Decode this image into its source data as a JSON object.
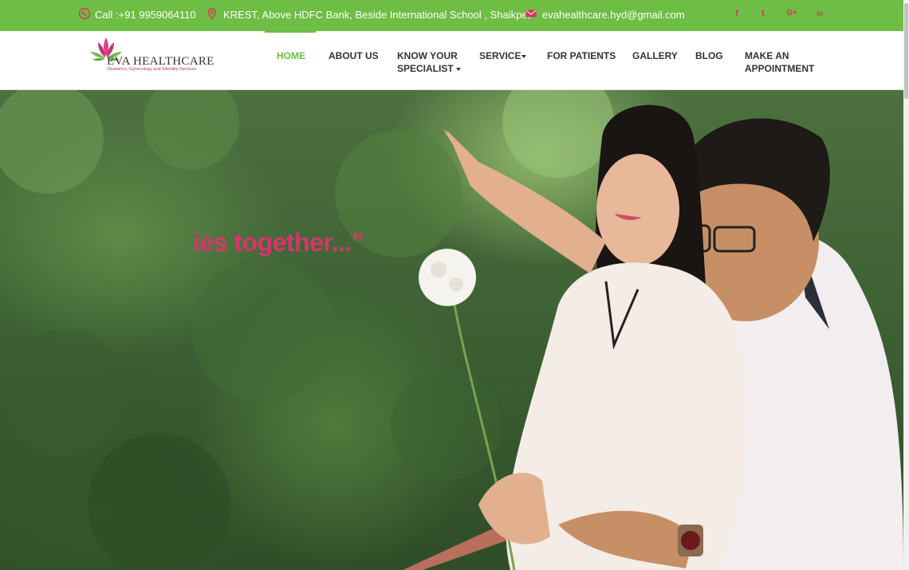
{
  "topbar": {
    "phone": "Call :+91 9959064110",
    "address": "KREST, Above HDFC Bank, Beside International School , Shaikpet",
    "email": "evahealthcare.hyd@gmail.com",
    "social": [
      {
        "icon": "facebook-icon",
        "glyph": "f"
      },
      {
        "icon": "twitter-icon",
        "glyph": "t"
      },
      {
        "icon": "google-plus-icon",
        "glyph": "G+"
      },
      {
        "icon": "linkedin-icon",
        "glyph": "in"
      }
    ],
    "bg_color": "#6ebd44"
  },
  "logo": {
    "name": "EVA HEALTHCARE",
    "tagline": "Obstetrics, Gynecology and Infertility Services"
  },
  "nav": {
    "home": "HOME",
    "about": "ABOUT US",
    "specialist_line1": "KNOW YOUR",
    "specialist_line2": "SPECIALIST",
    "service": "SERVICE",
    "patients": "FOR PATIENTS",
    "gallery": "GALLERY",
    "blog": "BLOG",
    "appointment_line1": "MAKE AN",
    "appointment_line2": "APPOINTMENT",
    "active_color": "#6ebd44"
  },
  "hero": {
    "text": "ies together...”",
    "text_color": "#d9346a"
  }
}
